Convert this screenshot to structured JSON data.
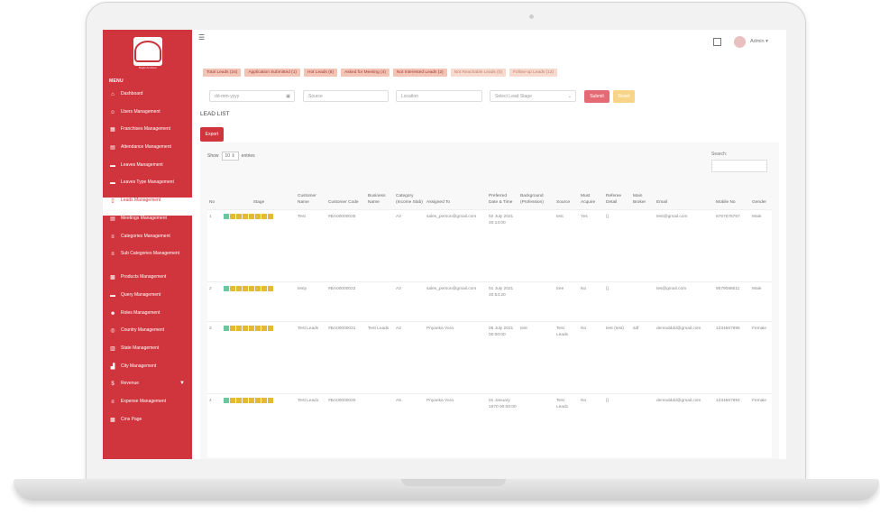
{
  "brand": {
    "logo_text": "ba",
    "caption": "Bright Ambition"
  },
  "sidebar": {
    "menu_title": "MENU",
    "items": [
      {
        "label": "Dashboard",
        "icon": "home-icon"
      },
      {
        "label": "Users Management",
        "icon": "user-icon"
      },
      {
        "label": "Franchises Management",
        "icon": "building-icon"
      },
      {
        "label": "Attendance Management",
        "icon": "calendar-icon"
      },
      {
        "label": "Leaves Management",
        "icon": "chat-icon"
      },
      {
        "label": "Leaves Type Management",
        "icon": "chat-icon"
      },
      {
        "label": "Leads Management",
        "icon": "document-icon"
      },
      {
        "label": "Meetings Management",
        "icon": "calendar-icon"
      },
      {
        "label": "Categories Management",
        "icon": "list-icon"
      },
      {
        "label": "Sub Categories Management",
        "icon": "list-icon"
      },
      {
        "label": "Products Management",
        "icon": "grid-icon"
      },
      {
        "label": "Query Management",
        "icon": "chat-icon"
      },
      {
        "label": "Roles Management",
        "icon": "users-icon"
      },
      {
        "label": "Country Management",
        "icon": "globe-icon"
      },
      {
        "label": "State Management",
        "icon": "map-icon"
      },
      {
        "label": "City Management",
        "icon": "city-icon"
      },
      {
        "label": "Revenue",
        "icon": "dollar-icon"
      },
      {
        "label": "Expense Management",
        "icon": "list-icon"
      },
      {
        "label": "Cms Page",
        "icon": "grid-icon"
      }
    ]
  },
  "header": {
    "admin_label": "Admin"
  },
  "stage_tabs": [
    "Total Leads (24)",
    "Application Submitted (1)",
    "Hot Leads (8)",
    "Asked for Meeting (4)",
    "Not Interested Leads (2)",
    "Not Reachable Leads (0)",
    "Follow-up Leads (13)"
  ],
  "filters": {
    "date_placeholder": "dd-mm-yyyy",
    "source_placeholder": "Source",
    "location_placeholder": "Location",
    "stage_placeholder": "Select Lead Stage",
    "submit_label": "Submit",
    "reset_label": "Reset"
  },
  "main": {
    "title": "LEAD LIST",
    "export_label": "Export",
    "show_label": "Show",
    "entries_value": "10",
    "entries_label": "entries",
    "search_label": "Search:"
  },
  "table": {
    "columns": [
      "No",
      "Stage",
      "Customer Name",
      "Customer Code",
      "Business Name",
      "Category (Income Slab)",
      "Assigned To",
      "Preferred Date & Time",
      "Background (Profession)",
      "Source",
      "Must Acquire",
      "Referee Detail",
      "Main Broker",
      "Email",
      "Mobile No",
      "Gender"
    ],
    "rows": [
      {
        "no": "1",
        "name": "Test",
        "code": "#BA00000025",
        "business": "",
        "category": "A2",
        "assigned": "sales_person@gmail.com",
        "date": "02 July 2021 20:13:00",
        "background": "",
        "source": "test",
        "must": "Yes",
        "referee": "{}",
        "broker": "",
        "email": "test@gmail.com",
        "mobile": "6767676767",
        "gender": "Male"
      },
      {
        "no": "2",
        "name": "testy",
        "code": "#BA00000022",
        "business": "",
        "category": "A2",
        "assigned": "sales_person@gmail.com",
        "date": "01 July 2021 20:54:20",
        "background": "",
        "source": "tree",
        "must": "No",
        "referee": "{}",
        "broker": "",
        "email": "tes@gmail.com",
        "mobile": "9579088611",
        "gender": "Male"
      },
      {
        "no": "3",
        "name": "Test Leads",
        "code": "#BA00000021",
        "business": "Test Leads",
        "category": "A2",
        "assigned": "Priyanka Vora",
        "date": "05 July 2021 00:00:00",
        "background": "test",
        "source": "Test Leads",
        "must": "No",
        "referee": "test (test)",
        "broker": "sdf",
        "email": "demodddd@gmail.com",
        "mobile": "1234567895",
        "gender": "Female"
      },
      {
        "no": "4",
        "name": "Test Lead1",
        "code": "#BA00000020",
        "business": "",
        "category": "A5",
        "assigned": "Priyanka Vora",
        "date": "01 January 1970 00:00:00",
        "background": "",
        "source": "Test Lead1",
        "must": "No",
        "referee": "{}",
        "broker": "",
        "email": "demodddd@gmail.com",
        "mobile": "1234567894",
        "gender": "Female"
      }
    ]
  },
  "colors": {
    "brand_red": "#d0343c",
    "stage_done": "#6cc6a2",
    "stage_pending": "#e3b936"
  }
}
